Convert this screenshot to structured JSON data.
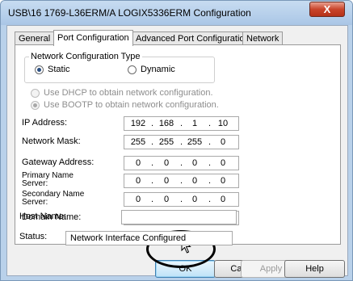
{
  "window": {
    "title": "USB\\16 1769-L36ERM/A LOGIX5336ERM Configuration",
    "close_glyph": "X"
  },
  "tabs": [
    {
      "label": "General",
      "active": false
    },
    {
      "label": "Port Configuration",
      "active": true
    },
    {
      "label": "Advanced Port Configuration",
      "active": false
    },
    {
      "label": "Network",
      "active": false
    }
  ],
  "network_config": {
    "group_label": "Network Configuration Type",
    "static_label": "Static",
    "dynamic_label": "Dynamic",
    "selected": "Static",
    "dhcp_label": "Use DHCP to obtain network configuration.",
    "bootp_label": "Use BOOTP to obtain network configuration."
  },
  "fields": {
    "ip_address": {
      "label": "IP Address:",
      "octets": [
        "192",
        "168",
        "1",
        "10"
      ]
    },
    "network_mask": {
      "label": "Network Mask:",
      "octets": [
        "255",
        "255",
        "255",
        "0"
      ]
    },
    "gateway_address": {
      "label": "Gateway Address:",
      "octets": [
        "0",
        "0",
        "0",
        "0"
      ]
    },
    "primary_name_server": {
      "label_line1": "Primary Name",
      "label_line2": "Server:",
      "octets": [
        "0",
        "0",
        "0",
        "0"
      ]
    },
    "secondary_name_server": {
      "label_line1": "Secondary Name",
      "label_line2": "Server:",
      "octets": [
        "0",
        "0",
        "0",
        "0"
      ]
    },
    "domain_name": {
      "label": "Domain Name:",
      "value": ""
    },
    "host_name": {
      "label": "Host Name:",
      "value": ""
    }
  },
  "status": {
    "label": "Status:",
    "value": "Network Interface Configured"
  },
  "buttons": {
    "ok": "OK",
    "cancel": "Cancel",
    "apply": "Apply",
    "help": "Help"
  },
  "colors": {
    "title_bar": "#aac6e6",
    "close_button": "#c9442b",
    "default_button": "#bfe3f8",
    "callout_circle": "#000000"
  }
}
